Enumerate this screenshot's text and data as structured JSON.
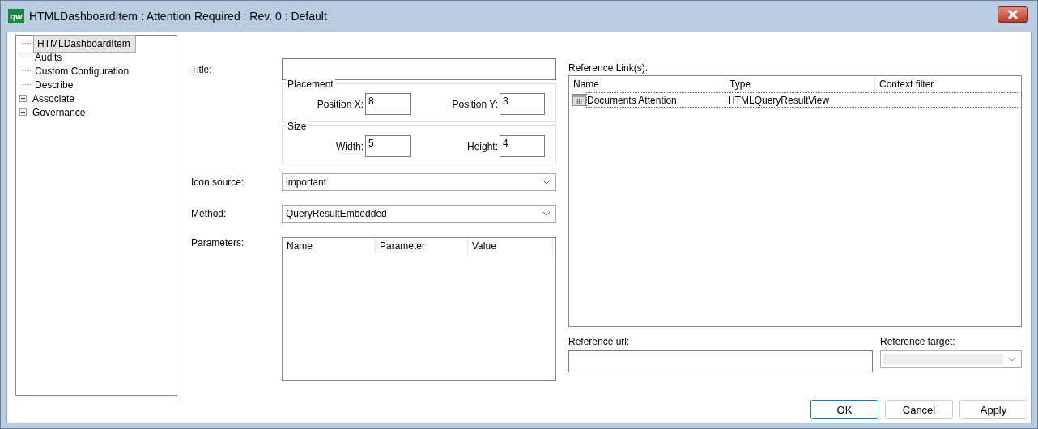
{
  "window": {
    "title": "HTMLDashboardItem : Attention Required : Rev. 0  : Default",
    "logo": "qw"
  },
  "tree": [
    {
      "label": "HTMLDashboardItem",
      "selected": true
    },
    {
      "label": "Audits",
      "selected": false
    },
    {
      "label": "Custom Configuration",
      "selected": false
    },
    {
      "label": "Describe",
      "selected": false
    },
    {
      "label": "Associate",
      "selected": false,
      "expanded": false
    },
    {
      "label": "Governance",
      "selected": false,
      "expanded": false
    }
  ],
  "form": {
    "title": {
      "label": "Title:"
    },
    "placement": {
      "legend": "Placement",
      "x_label": "Position X:",
      "x_value": "8",
      "y_label": "Position Y:",
      "y_value": "3"
    },
    "size": {
      "legend": "Size",
      "w_label": "Width:",
      "w_value": "5",
      "h_label": "Height:",
      "h_value": "4"
    },
    "icon_source": {
      "label": "Icon source:",
      "value": "important"
    },
    "method": {
      "label": "Method:",
      "value": "QueryResultEmbedded"
    },
    "parameters": {
      "label": "Parameters:",
      "columns": [
        "Name",
        "Parameter",
        "Value"
      ]
    }
  },
  "references": {
    "label": "Reference Link(s):",
    "columns": [
      "Name",
      "Type",
      "Context filter"
    ],
    "rows": [
      {
        "name": "Documents Attention",
        "type": "HTMLQueryResultView",
        "selected": true
      }
    ],
    "url_label": "Reference url:",
    "target_label": "Reference target:",
    "target_disabled": true
  },
  "buttons": [
    {
      "label": "OK",
      "default": true
    },
    {
      "label": "Cancel",
      "default": false
    },
    {
      "label": "Apply",
      "default": false
    }
  ]
}
